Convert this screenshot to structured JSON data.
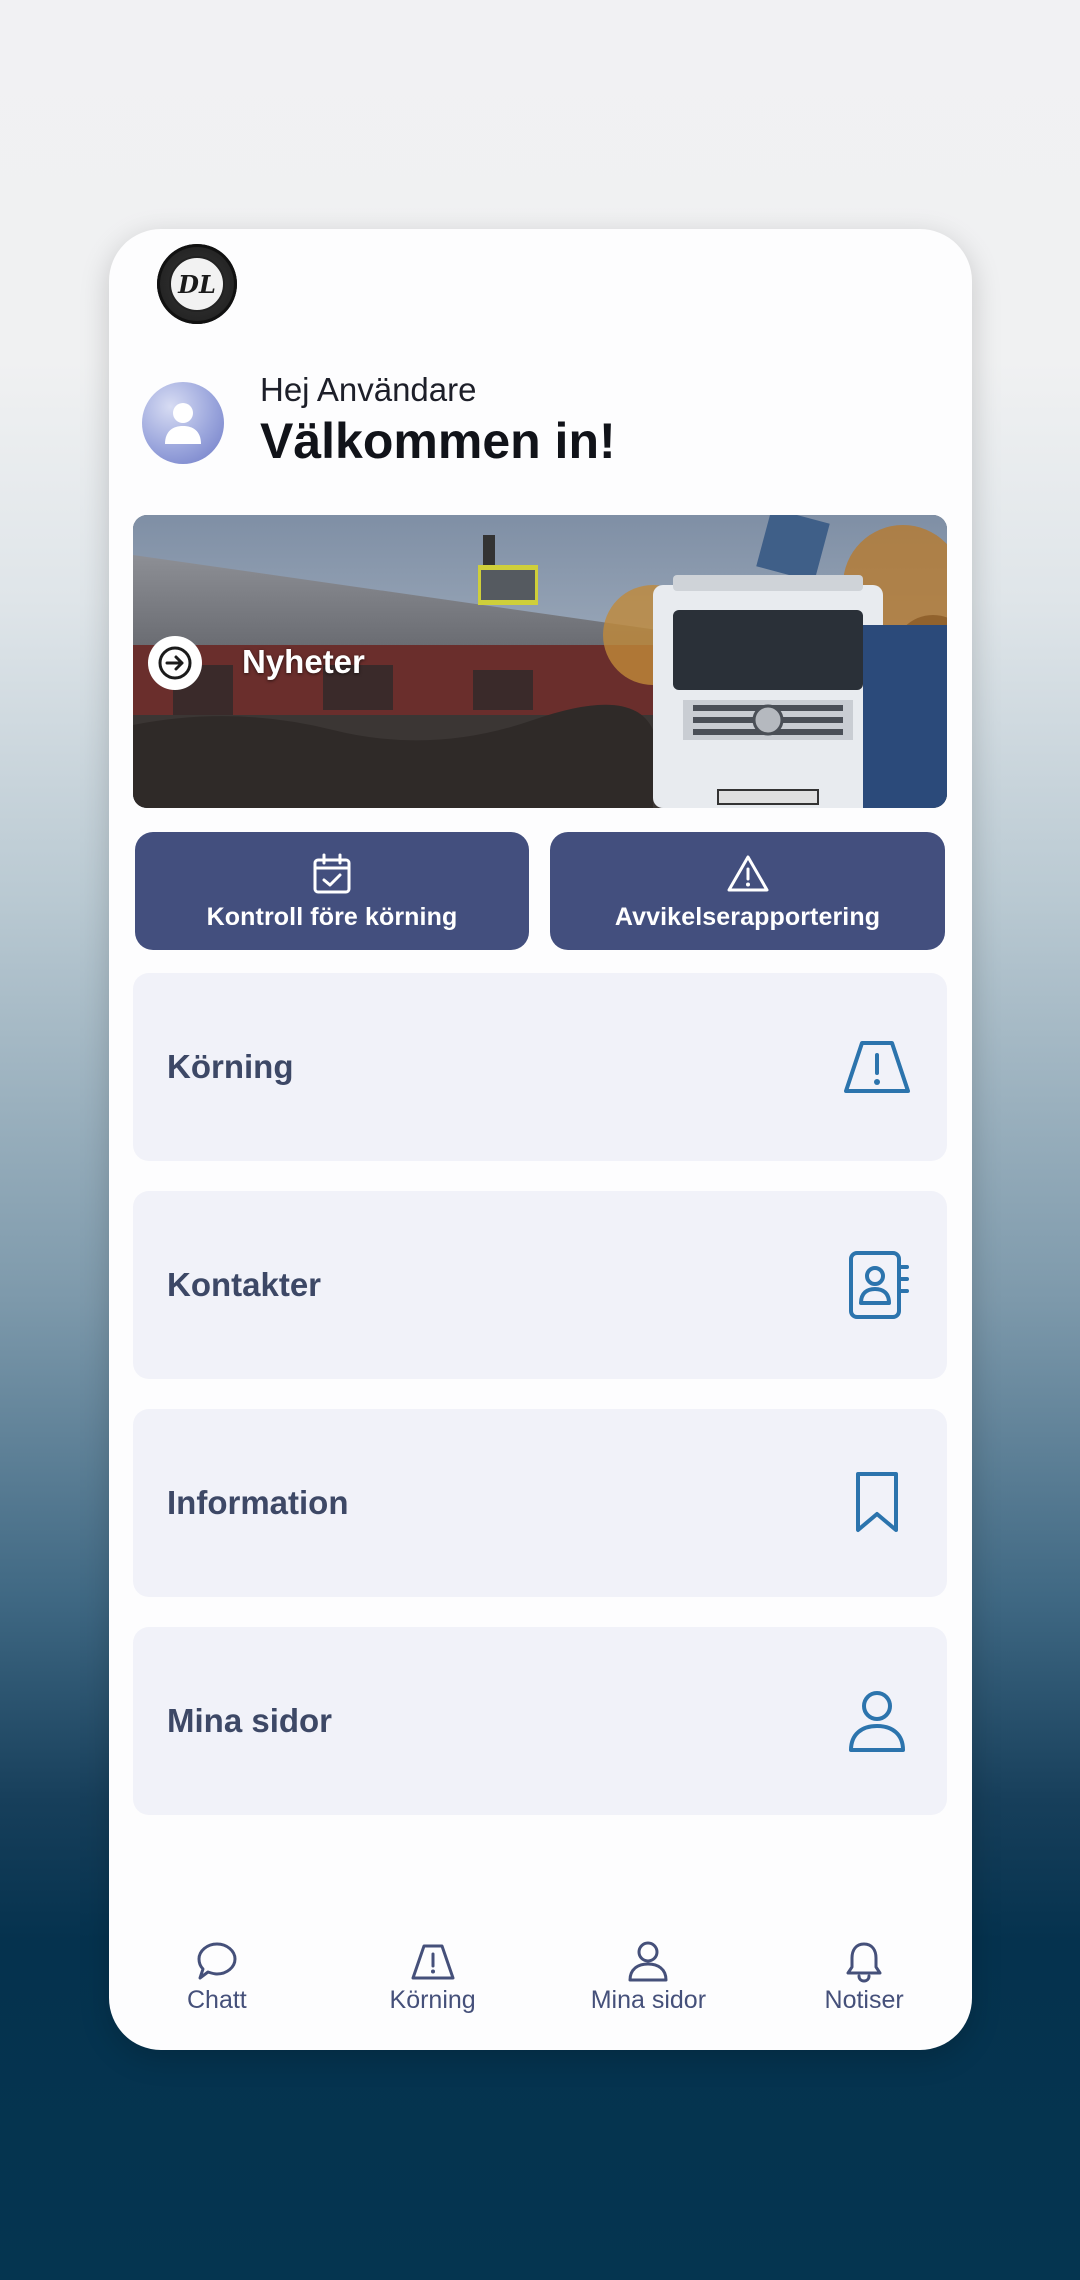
{
  "header": {
    "greeting_small": "Hej Användare",
    "greeting_big": "Välkommen in!"
  },
  "banner": {
    "label": "Nyheter"
  },
  "quick_actions": [
    {
      "label": "Kontroll före körning",
      "icon": "calendar-check-icon"
    },
    {
      "label": "Avvikelserapportering",
      "icon": "warning-triangle-icon"
    }
  ],
  "menu": [
    {
      "label": "Körning",
      "icon": "road-warning-icon"
    },
    {
      "label": "Kontakter",
      "icon": "contact-book-icon"
    },
    {
      "label": "Information",
      "icon": "bookmark-icon"
    },
    {
      "label": "Mina sidor",
      "icon": "user-icon"
    }
  ],
  "bottom_nav": [
    {
      "label": "Chatt",
      "icon": "chat-icon"
    },
    {
      "label": "Körning",
      "icon": "road-warning-icon"
    },
    {
      "label": "Mina sidor",
      "icon": "user-icon"
    },
    {
      "label": "Notiser",
      "icon": "bell-icon"
    }
  ],
  "colors": {
    "primary": "#434f7e",
    "tile_bg": "#f1f2f9",
    "icon_accent": "#2c74ad",
    "nav_text": "#45507a"
  }
}
